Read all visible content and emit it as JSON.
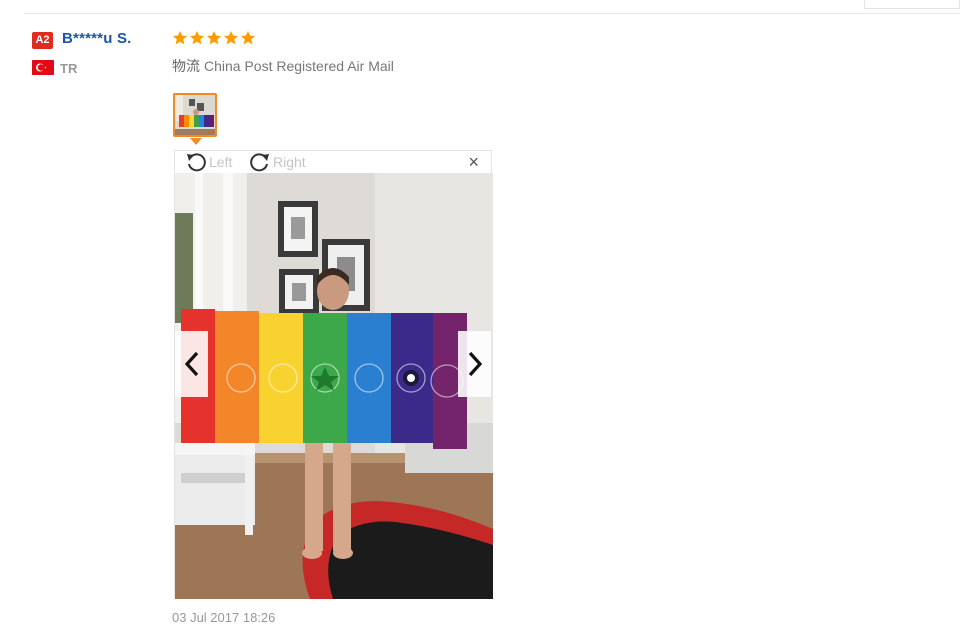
{
  "reviewer": {
    "level_badge": "A2",
    "name": "B*****u S.",
    "country_code": "TR",
    "flag_icon": "turkey-flag-icon"
  },
  "review": {
    "rating": 5,
    "rating_max": 5,
    "shipping_label": "物流",
    "shipping_method": "China Post Registered Air Mail",
    "date": "03 Jul 2017 18:26"
  },
  "image_viewer": {
    "rotate_left_label": "Left",
    "rotate_right_label": "Right",
    "close_glyph": "×",
    "prev_icon": "chevron-left-icon",
    "next_icon": "chevron-right-icon"
  },
  "colors": {
    "badge_red": "#e02b1f",
    "name_blue": "#1a56a6",
    "star_orange": "#ff9c00",
    "thumb_border": "#f08a24"
  }
}
